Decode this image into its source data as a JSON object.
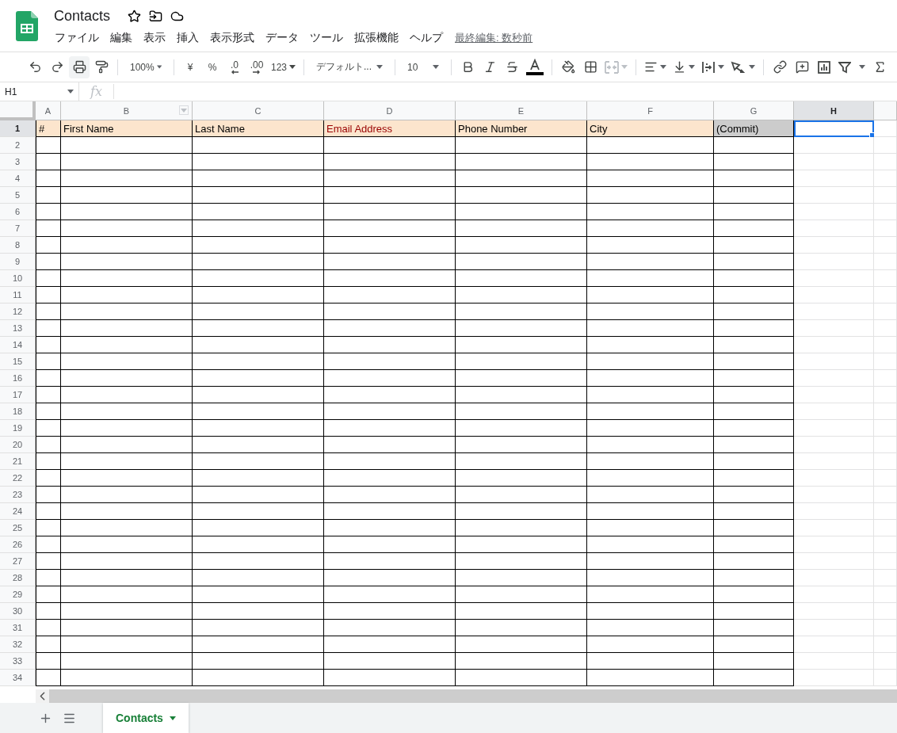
{
  "document": {
    "title": "Contacts",
    "last_edit": "最終編集: 数秒前"
  },
  "menu": [
    "ファイル",
    "編集",
    "表示",
    "挿入",
    "表示形式",
    "データ",
    "ツール",
    "拡張機能",
    "ヘルプ"
  ],
  "toolbar": [
    {
      "kind": "undo"
    },
    {
      "kind": "redo"
    },
    {
      "kind": "print",
      "selected": true
    },
    {
      "kind": "paintformat"
    },
    {
      "kind": "separator"
    },
    {
      "kind": "dropdown",
      "label": "100%",
      "wide": false
    },
    {
      "kind": "separator"
    },
    {
      "kind": "text",
      "label": "¥"
    },
    {
      "kind": "text",
      "label": "%"
    },
    {
      "kind": "decimal-less",
      "label": ".0"
    },
    {
      "kind": "decimal-more",
      "label": ".00"
    },
    {
      "kind": "menu",
      "label": "123"
    },
    {
      "kind": "separator"
    },
    {
      "kind": "dropdown",
      "label": "デフォルト...",
      "wide": true
    },
    {
      "kind": "separator"
    },
    {
      "kind": "dropdown",
      "label": "10",
      "wide": false
    },
    {
      "kind": "separator"
    },
    {
      "kind": "bold"
    },
    {
      "kind": "italic"
    },
    {
      "kind": "strike"
    },
    {
      "kind": "textcolor",
      "color": "#000000"
    },
    {
      "kind": "separator"
    },
    {
      "kind": "fill"
    },
    {
      "kind": "borders"
    },
    {
      "kind": "merge",
      "disabled": true
    },
    {
      "kind": "separator"
    },
    {
      "kind": "halign"
    },
    {
      "kind": "valign"
    },
    {
      "kind": "wrap"
    },
    {
      "kind": "rotate"
    },
    {
      "kind": "separator"
    },
    {
      "kind": "link"
    },
    {
      "kind": "comment"
    },
    {
      "kind": "chart"
    },
    {
      "kind": "filter"
    },
    {
      "kind": "functions"
    }
  ],
  "formula_bar": {
    "cell": "H1",
    "fx": "fx"
  },
  "columns": [
    {
      "label": "A",
      "selected": false,
      "filter": false
    },
    {
      "label": "B",
      "selected": false,
      "filter": true
    },
    {
      "label": "C",
      "selected": false,
      "filter": false
    },
    {
      "label": "D",
      "selected": false,
      "filter": false
    },
    {
      "label": "E",
      "selected": false,
      "filter": false
    },
    {
      "label": "F",
      "selected": false,
      "filter": false
    },
    {
      "label": "G",
      "selected": false,
      "filter": false
    },
    {
      "label": "H",
      "selected": true,
      "filter": false
    }
  ],
  "header_row": [
    {
      "text": "#",
      "color": "#000000",
      "kind": "header"
    },
    {
      "text": "First Name",
      "color": "#000000",
      "kind": "header"
    },
    {
      "text": "Last Name",
      "color": "#000000",
      "kind": "header"
    },
    {
      "text": "Email Address",
      "color": "#990000",
      "kind": "header"
    },
    {
      "text": "Phone Number",
      "color": "#000000",
      "kind": "header"
    },
    {
      "text": "City",
      "color": "#000000",
      "kind": "header"
    },
    {
      "text": "(Commit)",
      "color": "#000000",
      "kind": "commit"
    }
  ],
  "row_headers": [
    {
      "label": "1",
      "selected": true
    },
    {
      "label": "2",
      "selected": false
    },
    {
      "label": "3",
      "selected": false
    },
    {
      "label": "4",
      "selected": false
    },
    {
      "label": "5",
      "selected": false
    },
    {
      "label": "6",
      "selected": false
    },
    {
      "label": "7",
      "selected": false
    },
    {
      "label": "8",
      "selected": false
    },
    {
      "label": "9",
      "selected": false
    },
    {
      "label": "10",
      "selected": false
    },
    {
      "label": "11",
      "selected": false
    },
    {
      "label": "12",
      "selected": false
    },
    {
      "label": "13",
      "selected": false
    },
    {
      "label": "14",
      "selected": false
    },
    {
      "label": "15",
      "selected": false
    },
    {
      "label": "16",
      "selected": false
    },
    {
      "label": "17",
      "selected": false
    },
    {
      "label": "18",
      "selected": false
    },
    {
      "label": "19",
      "selected": false
    },
    {
      "label": "20",
      "selected": false
    },
    {
      "label": "21",
      "selected": false
    },
    {
      "label": "22",
      "selected": false
    },
    {
      "label": "23",
      "selected": false
    },
    {
      "label": "24",
      "selected": false
    },
    {
      "label": "25",
      "selected": false
    },
    {
      "label": "26",
      "selected": false
    },
    {
      "label": "27",
      "selected": false
    },
    {
      "label": "28",
      "selected": false
    },
    {
      "label": "29",
      "selected": false
    },
    {
      "label": "30",
      "selected": false
    },
    {
      "label": "31",
      "selected": false
    },
    {
      "label": "32",
      "selected": false
    },
    {
      "label": "33",
      "selected": false
    },
    {
      "label": "34",
      "selected": false
    }
  ],
  "sheets": [
    {
      "label": "Contacts",
      "selected": true
    }
  ]
}
